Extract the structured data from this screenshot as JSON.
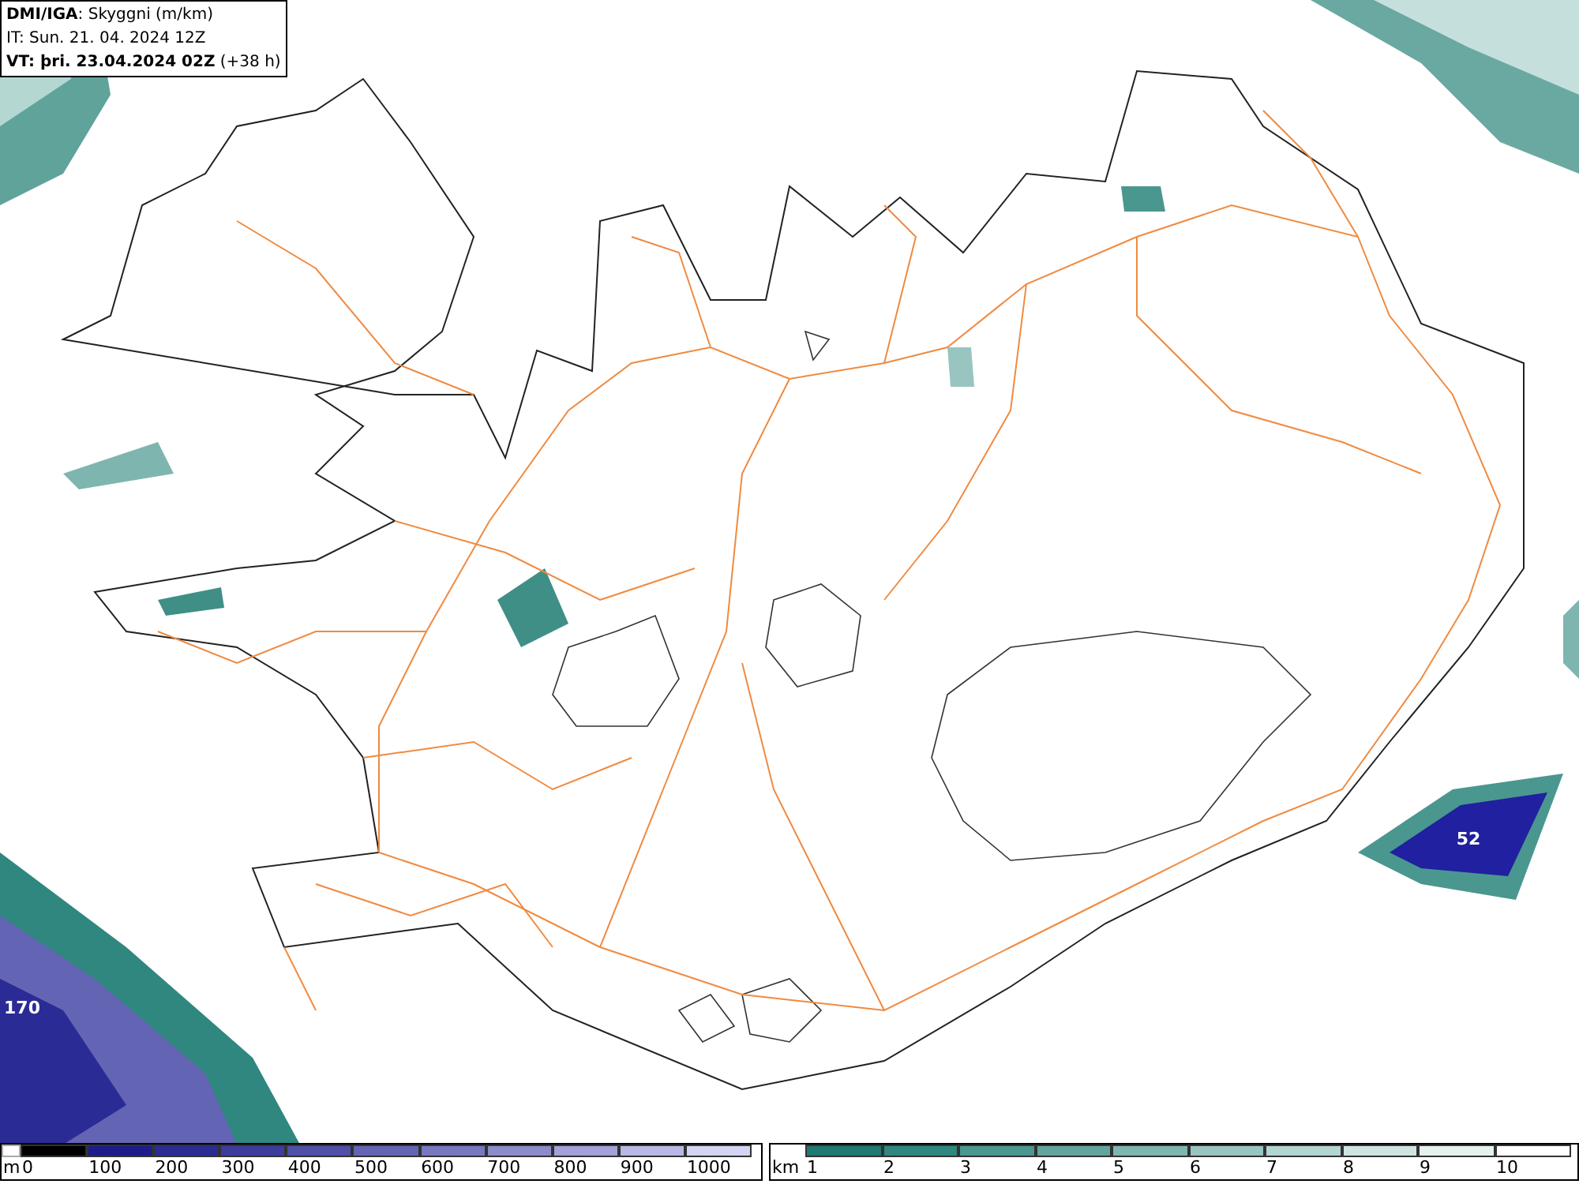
{
  "header": {
    "title": "**DMI/IGA**: Skyggni (m/km)",
    "issue_time": "IT: Sun. 21. 04. 2024 12Z",
    "valid_time": "**VT: þri. 23.04.2024 02Z** (+38 h)"
  },
  "map": {
    "labels": [
      {
        "text": "52",
        "kind": "east"
      },
      {
        "text": "170",
        "kind": "southwest"
      }
    ]
  },
  "legend_m": {
    "unit": "m",
    "items": [
      {
        "label": "0",
        "color": "#000000"
      },
      {
        "label": "100",
        "color": "#1c1c8c"
      },
      {
        "label": "200",
        "color": "#2b2b96"
      },
      {
        "label": "300",
        "color": "#3d3d9e"
      },
      {
        "label": "400",
        "color": "#5050a8"
      },
      {
        "label": "500",
        "color": "#6464b4"
      },
      {
        "label": "600",
        "color": "#7878c0"
      },
      {
        "label": "700",
        "color": "#8c8ccb"
      },
      {
        "label": "800",
        "color": "#a2a2d8"
      },
      {
        "label": "900",
        "color": "#b8b8e4"
      },
      {
        "label": "1000",
        "color": "#d4d4f2"
      }
    ]
  },
  "legend_km": {
    "unit": "km",
    "items": [
      {
        "label": "1",
        "color": "#1f7a72"
      },
      {
        "label": "2",
        "color": "#2f8780"
      },
      {
        "label": "3",
        "color": "#4a978f"
      },
      {
        "label": "4",
        "color": "#63a59e"
      },
      {
        "label": "5",
        "color": "#7fb5af"
      },
      {
        "label": "6",
        "color": "#98c5c0"
      },
      {
        "label": "7",
        "color": "#b3d5d1"
      },
      {
        "label": "8",
        "color": "#cfe4e1"
      },
      {
        "label": "9",
        "color": "#e6f1ef"
      },
      {
        "label": "10",
        "color": "#ffffff"
      }
    ]
  }
}
